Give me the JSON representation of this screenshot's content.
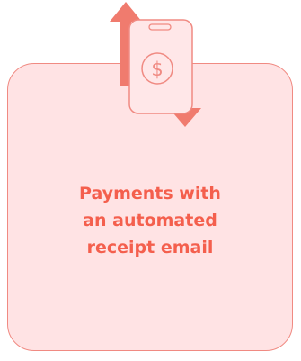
{
  "card": {
    "lines": [
      "Payments with",
      "an automated",
      "receipt email"
    ]
  },
  "illustration": {
    "icon": "phone-dollar-transfer-icon",
    "coin_symbol": "$"
  },
  "colors": {
    "accent": "#f45f4d",
    "arrow": "#f07b6e",
    "card_background": "#ffe3e4",
    "card_border": "#f08a82",
    "phone_fill": "#ffe7e8",
    "phone_stroke": "#f08a82"
  }
}
